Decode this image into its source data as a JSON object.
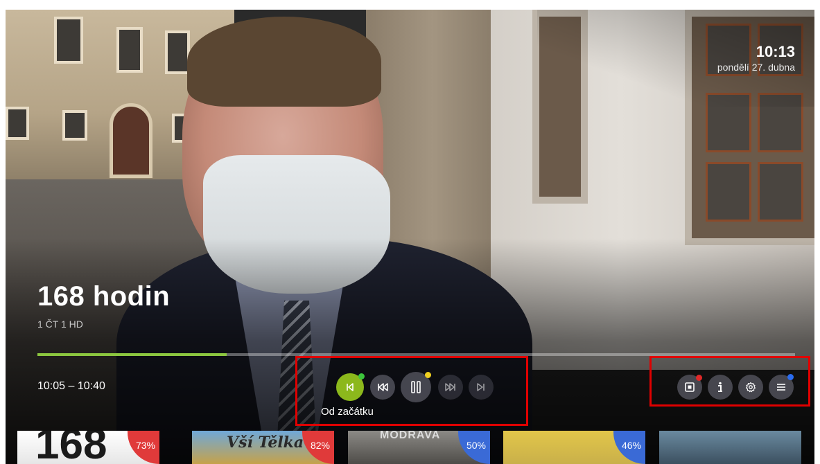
{
  "clock": {
    "time": "10:13",
    "date": "pondělí 27. dubna"
  },
  "program": {
    "title": "168 hodin",
    "channel": "1 ČT 1 HD",
    "time_range": "10:05 – 10:40",
    "progress": 0.25
  },
  "player_controls": [
    {
      "name": "from-start",
      "label": "Od začátku",
      "icon": "skip-to-start-icon",
      "state": "selected",
      "dot": "green"
    },
    {
      "name": "rewind",
      "icon": "rewind-icon"
    },
    {
      "name": "play-pause",
      "icon": "pause-icon",
      "dot": "yellow"
    },
    {
      "name": "fast-forward",
      "icon": "fast-forward-icon",
      "state": "disabled"
    },
    {
      "name": "skip-to-live",
      "icon": "skip-to-end-icon",
      "state": "disabled"
    }
  ],
  "focused_label": "Od začátku",
  "utility_controls": [
    {
      "name": "record",
      "icon": "record-icon",
      "dot": "red"
    },
    {
      "name": "info",
      "icon": "info-icon"
    },
    {
      "name": "settings",
      "icon": "gear-icon"
    },
    {
      "name": "menu",
      "icon": "menu-icon",
      "dot": "blue"
    }
  ],
  "recommendations": [
    {
      "text": "168",
      "percent": "73%",
      "color": "#e03a3a"
    },
    {
      "text": "Vší Tělka",
      "percent": "82%",
      "color": "#e03a3a"
    },
    {
      "text": "MODRAVA",
      "percent": "50%",
      "color": "#3a6ad6"
    },
    {
      "text": "",
      "percent": "46%",
      "color": "#3a6ad6"
    },
    {
      "text": "",
      "percent": "",
      "color": ""
    }
  ]
}
